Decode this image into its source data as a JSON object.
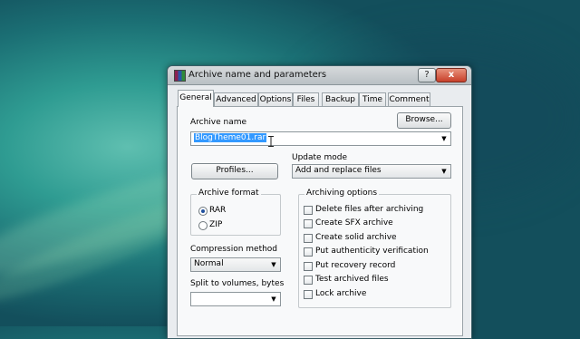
{
  "window": {
    "title": "Archive name and parameters",
    "help_glyph": "?",
    "close_glyph": "x"
  },
  "tabs": [
    {
      "label": "General",
      "active": true
    },
    {
      "label": "Advanced"
    },
    {
      "label": "Options"
    },
    {
      "label": "Files"
    },
    {
      "label": "Backup"
    },
    {
      "label": "Time"
    },
    {
      "label": "Comment"
    }
  ],
  "archive_name": {
    "label": "Archive name",
    "value": "BlogTheme01.rar",
    "browse_label": "Browse..."
  },
  "profiles_label": "Profiles...",
  "update_mode": {
    "label": "Update mode",
    "value": "Add and replace files"
  },
  "archive_format": {
    "title": "Archive format",
    "options": [
      {
        "label": "RAR",
        "checked": true
      },
      {
        "label": "ZIP",
        "checked": false
      }
    ]
  },
  "compression": {
    "label": "Compression method",
    "value": "Normal"
  },
  "split": {
    "label": "Split to volumes, bytes",
    "value": ""
  },
  "archiving_options": {
    "title": "Archiving options",
    "items": [
      {
        "label": "Delete files after archiving",
        "checked": false
      },
      {
        "label": "Create SFX archive",
        "checked": false
      },
      {
        "label": "Create solid archive",
        "checked": false
      },
      {
        "label": "Put authenticity verification",
        "checked": false
      },
      {
        "label": "Put recovery record",
        "checked": false
      },
      {
        "label": "Test archived files",
        "checked": false
      },
      {
        "label": "Lock archive",
        "checked": false
      }
    ]
  },
  "icons": {
    "dropdown": "chevron-down-icon",
    "app": "winrar-icon",
    "cursor": "text-cursor-icon"
  }
}
